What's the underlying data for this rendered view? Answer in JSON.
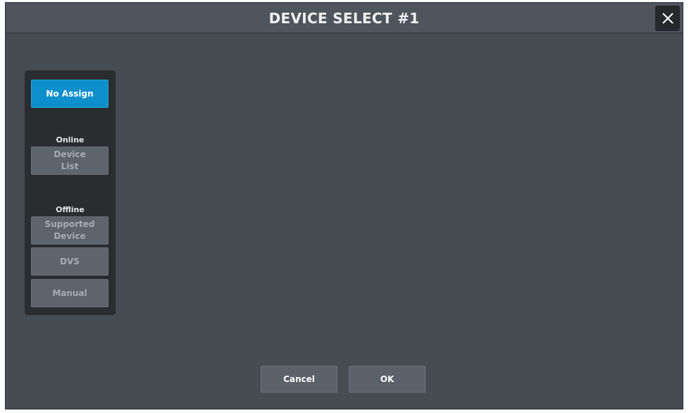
{
  "dialog": {
    "title": "DEVICE SELECT #1",
    "close_icon": "close-icon"
  },
  "side_panel": {
    "no_assign_label": "No Assign",
    "online_label": "Online",
    "device_list_label": "Device\nList",
    "offline_label": "Offline",
    "supported_device_label": "Supported\nDevice",
    "dvs_label": "DVS",
    "manual_label": "Manual"
  },
  "footer": {
    "cancel_label": "Cancel",
    "ok_label": "OK"
  },
  "colors": {
    "accent": "#0d8fcb",
    "background": "#474b52",
    "panel": "#2a2c30"
  }
}
